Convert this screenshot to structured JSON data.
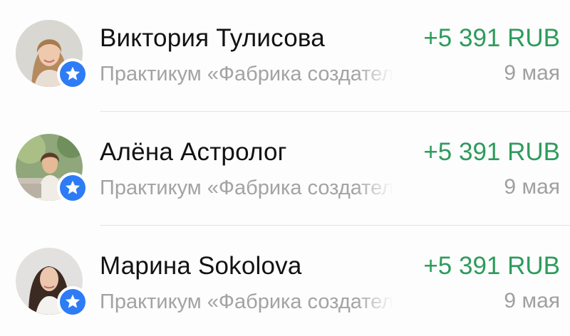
{
  "transactions": [
    {
      "name": "Виктория Тулисова",
      "subtitle": "Практикум «Фабрика создателей",
      "amount": "+5 391 RUB",
      "date": "9 мая",
      "avatar_icon": "avatar-photo-woman-light-hair",
      "badge_icon": "star-icon"
    },
    {
      "name": "Алёна Астролог",
      "subtitle": "Практикум «Фабрика создателей",
      "amount": "+5 391 RUB",
      "date": "9 мая",
      "avatar_icon": "avatar-photo-woman-garden",
      "badge_icon": "star-icon"
    },
    {
      "name": "Марина Sokolova",
      "subtitle": "Практикум «Фабрика создателей",
      "amount": "+5 391 RUB",
      "date": "9 мая",
      "avatar_icon": "avatar-photo-woman-dark-hair",
      "badge_icon": "star-icon"
    }
  ],
  "colors": {
    "amount_green": "#2d9b5c",
    "badge_blue": "#2d7cf6",
    "secondary_gray": "#a3a3a3"
  }
}
